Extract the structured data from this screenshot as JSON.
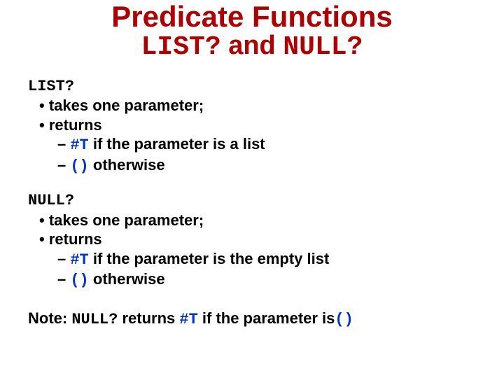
{
  "title": {
    "line1": "Predicate Functions",
    "code1": "LIST?",
    "mid": " and ",
    "code2": "NULL?"
  },
  "listSection": {
    "head": "LIST?",
    "b1": "takes one parameter;",
    "b2": "returns",
    "d1code": "#T",
    "d1rest": " if the parameter is a list",
    "d2code": "()",
    "d2rest": " otherwise"
  },
  "nullSection": {
    "head": "NULL?",
    "b1": "takes one parameter;",
    "b2": "returns",
    "d1code": "#T",
    "d1rest": " if the parameter is the empty list",
    "d2code": "()",
    "d2rest": " otherwise"
  },
  "note": {
    "prefix": "Note: ",
    "code1": "NULL?",
    "mid1": " returns ",
    "code2": "#T",
    "mid2": " if the parameter is",
    "code3": "()"
  }
}
